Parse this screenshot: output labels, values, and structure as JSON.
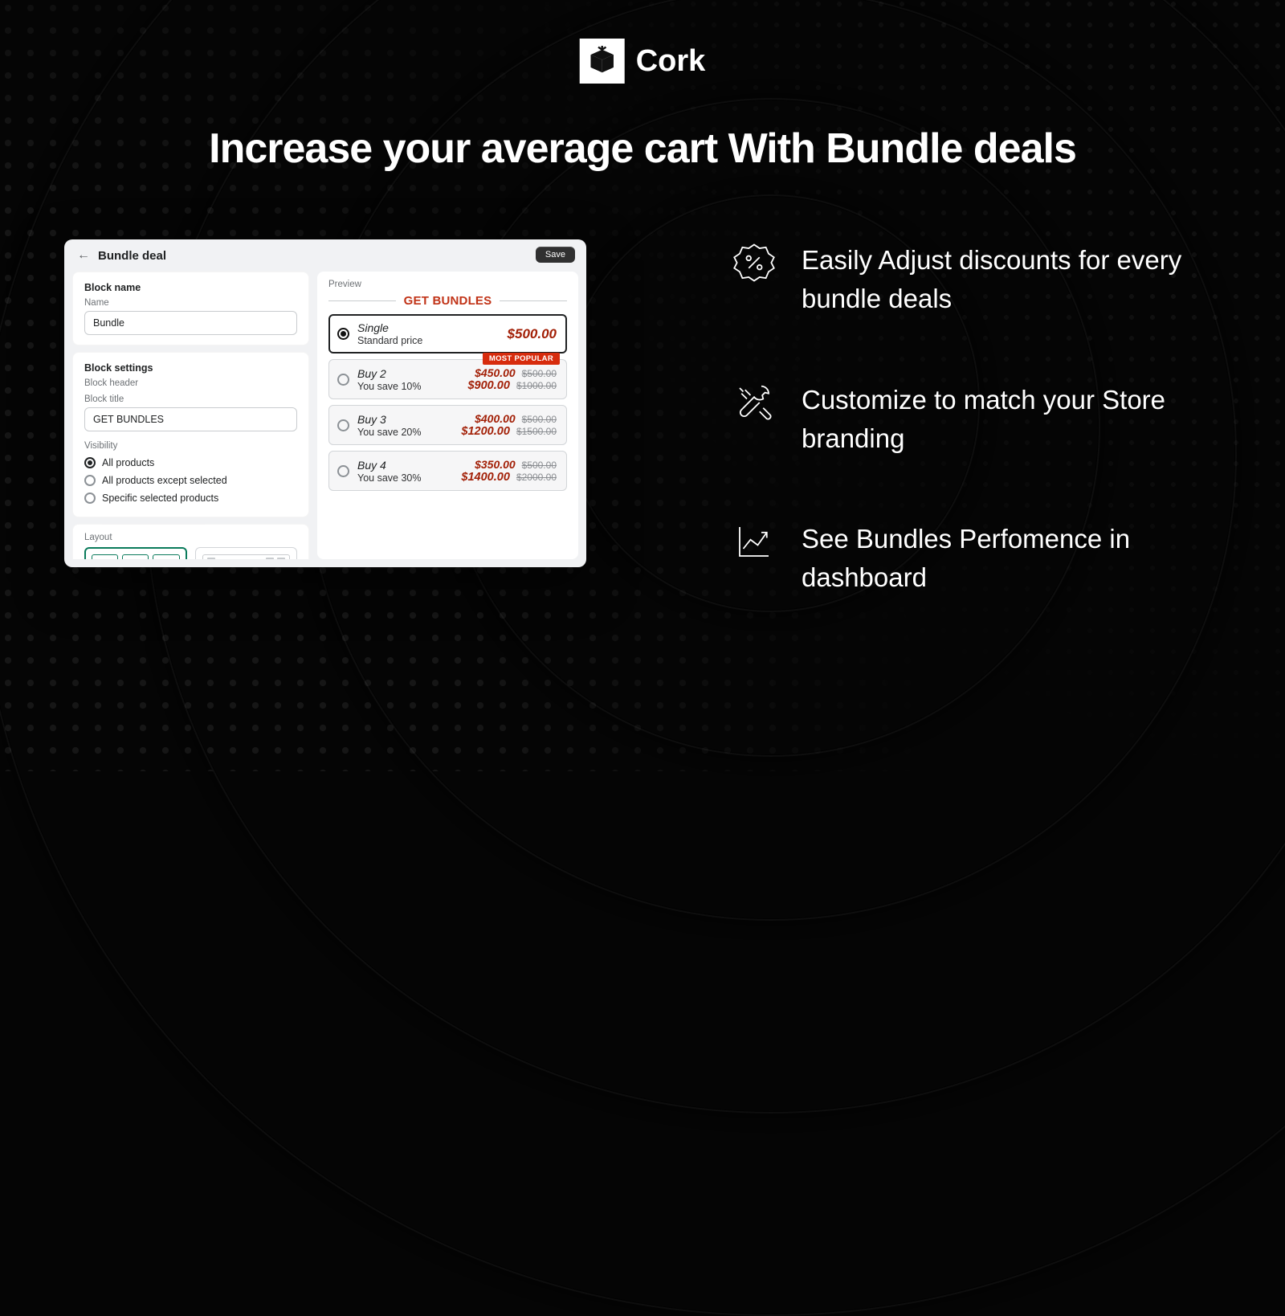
{
  "brand": {
    "name": "Cork"
  },
  "headline": "Increase your average cart  With Bundle deals",
  "features": [
    {
      "icon": "discount-badge-icon",
      "text": "Easily Adjust discounts for every bundle deals"
    },
    {
      "icon": "tools-icon",
      "text": "Customize to match your Store branding"
    },
    {
      "icon": "analytics-icon",
      "text": "See Bundles Perfomence in dashboard"
    }
  ],
  "panel": {
    "title": "Bundle deal",
    "save_label": "Save",
    "block_name": {
      "section": "Block name",
      "label": "Name",
      "value": "Bundle"
    },
    "block_settings": {
      "section": "Block settings",
      "header_label": "Block header",
      "title_label": "Block title",
      "title_value": "GET BUNDLES",
      "visibility_label": "Visibility",
      "visibility_options": [
        {
          "label": "All products",
          "selected": true
        },
        {
          "label": "All products except selected",
          "selected": false
        },
        {
          "label": "Specific selected products",
          "selected": false
        }
      ]
    },
    "layout_label": "Layout",
    "preview": {
      "label": "Preview",
      "title": "GET BUNDLES",
      "popular_badge": "MOST POPULAR",
      "options": [
        {
          "name": "Single",
          "sub": "Standard price",
          "single": true,
          "price": "$500.00",
          "selected": true
        },
        {
          "name": "Buy 2",
          "sub": "You save 10%",
          "unit": "$450.00",
          "unit_strike": "$500.00",
          "total": "$900.00",
          "total_strike": "$1000.00",
          "popular": true
        },
        {
          "name": "Buy 3",
          "sub": "You save 20%",
          "unit": "$400.00",
          "unit_strike": "$500.00",
          "total": "$1200.00",
          "total_strike": "$1500.00"
        },
        {
          "name": "Buy 4",
          "sub": "You save 30%",
          "unit": "$350.00",
          "unit_strike": "$500.00",
          "total": "$1400.00",
          "total_strike": "$2000.00"
        }
      ]
    }
  }
}
